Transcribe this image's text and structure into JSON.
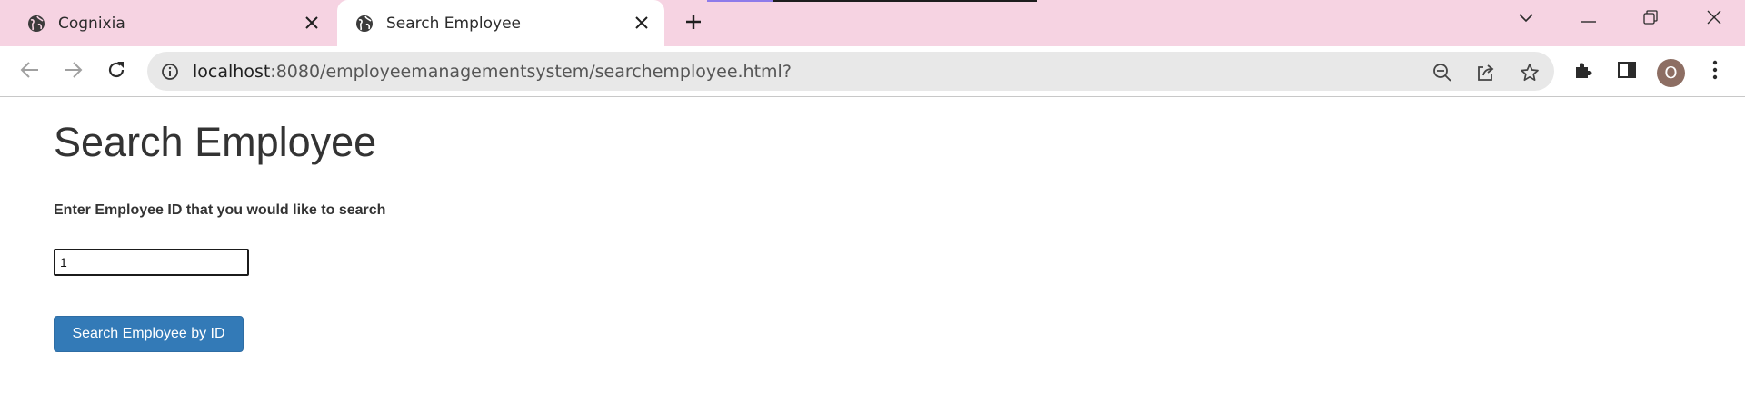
{
  "browser": {
    "tabs": [
      {
        "title": "Cognixia",
        "active": false
      },
      {
        "title": "Search Employee",
        "active": true
      }
    ],
    "address": {
      "host": "localhost",
      "rest": ":8080/employeemanagementsystem/searchemployee.html?"
    },
    "profile_initial": "O"
  },
  "page": {
    "heading": "Search Employee",
    "prompt_label": "Enter Employee ID that you would like to search",
    "employee_id_value": "1",
    "search_button_label": "Search Employee by ID"
  },
  "colors": {
    "tabstrip_bg": "#f6d3e2",
    "primary_button": "#337ab7",
    "avatar_bg": "#8d6e63"
  },
  "icons": [
    "globe-icon",
    "close-icon",
    "plus-icon",
    "chevron-down-icon",
    "minimize-icon",
    "restore-icon",
    "window-close-icon",
    "back-arrow-icon",
    "forward-arrow-icon",
    "reload-icon",
    "info-icon",
    "zoom-out-icon",
    "share-icon",
    "star-icon",
    "extensions-icon",
    "side-panel-icon",
    "more-vert-icon"
  ]
}
